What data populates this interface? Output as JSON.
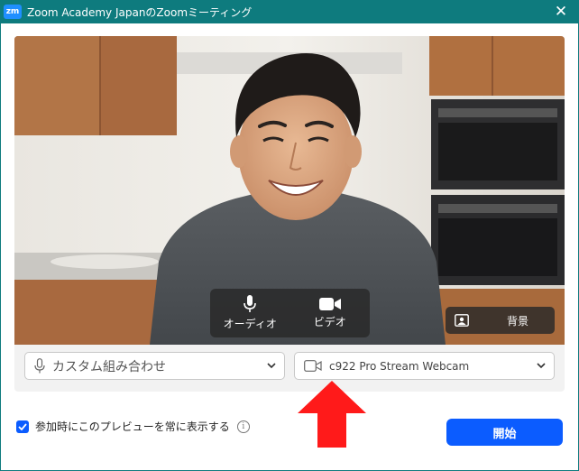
{
  "window": {
    "logo_text": "zm",
    "title": "Zoom Academy JapanのZoomミーティング",
    "close_glyph": "✕"
  },
  "preview": {
    "audio_button_label": "オーディオ",
    "video_button_label": "ビデオ",
    "background_button_label": "背景"
  },
  "devices": {
    "audio_selected": "カスタム組み合わせ",
    "video_selected": "c922 Pro Stream Webcam"
  },
  "options": {
    "always_show_preview_label": "参加時にこのプレビューを常に表示する",
    "always_show_preview_checked": true,
    "info_glyph": "i"
  },
  "actions": {
    "start_label": "開始"
  },
  "colors": {
    "titlebar": "#0e7b7e",
    "accent": "#0b5cff",
    "annotation_arrow": "#ff1a1a"
  },
  "icons": [
    "zoom-logo-icon",
    "close-icon",
    "microphone-icon",
    "video-camera-icon",
    "virtual-background-icon",
    "chevron-down-icon",
    "checkmark-icon",
    "info-icon",
    "red-arrow-annotation"
  ]
}
